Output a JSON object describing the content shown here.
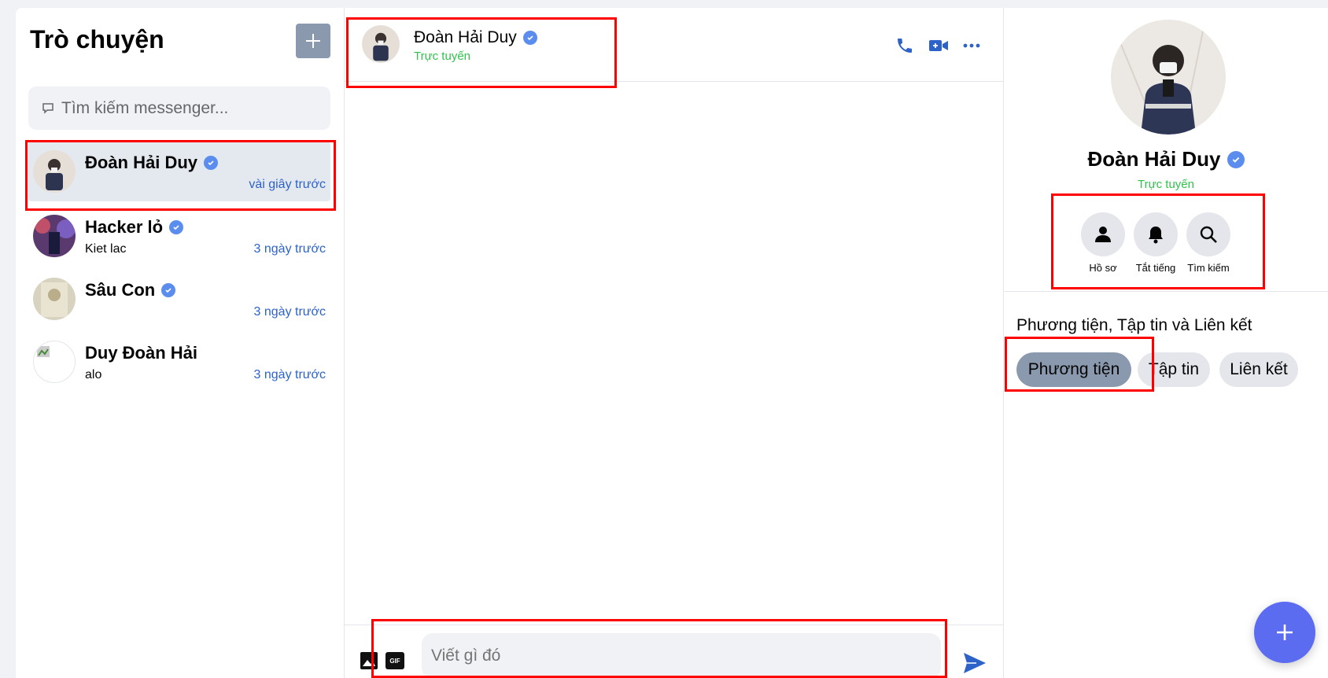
{
  "left": {
    "title": "Trò chuyện",
    "search_placeholder": "Tìm kiếm messenger...",
    "conversations": [
      {
        "name": "Đoàn Hải Duy",
        "last": "",
        "time": "vài giây trước",
        "verified": true
      },
      {
        "name": "Hacker lỏ",
        "last": "Kiet lac",
        "time": "3 ngày trước",
        "verified": true
      },
      {
        "name": "Sâu Con",
        "last": "",
        "time": "3 ngày trước",
        "verified": true
      },
      {
        "name": "Duy Đoàn Hải",
        "last": "alo",
        "time": "3 ngày trước",
        "verified": false
      }
    ]
  },
  "chat": {
    "name": "Đoàn Hải Duy",
    "status": "Trực tuyến",
    "composer_placeholder": "Viết gì đó",
    "gif_label": "GIF"
  },
  "profile": {
    "name": "Đoàn Hải Duy",
    "status": "Trực tuyến",
    "actions": [
      "Hồ sơ",
      "Tắt tiếng",
      "Tìm kiếm"
    ],
    "media_title": "Phương tiện, Tập tin và Liên kết",
    "chips": [
      "Phương tiện",
      "Tập tin",
      "Liên kết"
    ]
  },
  "colors": {
    "accent": "#2d62c8",
    "online": "#31c24d",
    "fab": "#5b6cf0",
    "highlight": "#ff0000"
  }
}
